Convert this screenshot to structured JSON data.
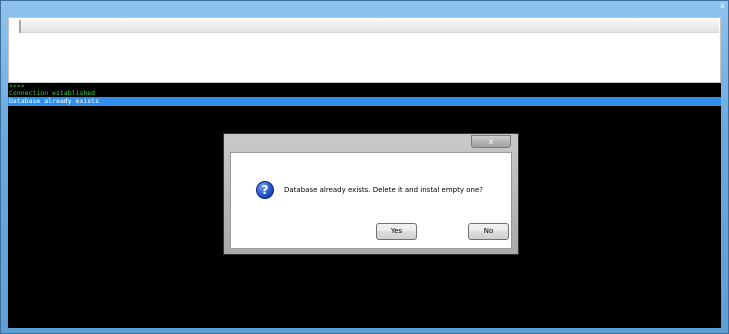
{
  "window": {
    "close_glyph": "x"
  },
  "console": {
    "lines": [
      {
        "text": "****"
      },
      {
        "text": "Connection established"
      },
      {
        "text": "Database already exists"
      }
    ]
  },
  "dialog": {
    "close_glyph": "x",
    "message": "Database already exists. Delete it and instal empty one?",
    "icon": "question-icon",
    "icon_glyph": "?",
    "buttons": {
      "yes": "Yes",
      "no": "No"
    }
  },
  "colors": {
    "selection": "#2f8fea",
    "console_text": "#40d040",
    "console_bg": "#000000"
  }
}
